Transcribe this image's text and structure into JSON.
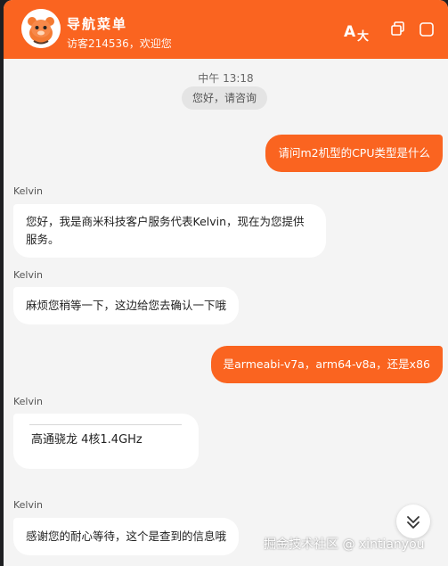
{
  "header": {
    "title": "导航菜单",
    "subtitle": "访客214536，欢迎您",
    "translate_icon": "translate-icon",
    "window_icon": "window-popout-icon",
    "avatar_icon": "mascot-avatar-icon",
    "accent": "#fa6420"
  },
  "chat": {
    "time": "中午 13:18",
    "system_message": "您好，请咨询",
    "messages": [
      {
        "sender": "",
        "text": "请问m2机型的CPU类型是什么"
      },
      {
        "sender": "Kelvin",
        "text_line1": "您好，我是商米科技客户服务代表Kelvin，现在为您提供",
        "text_line2": "服务。"
      },
      {
        "sender": "Kelvin",
        "text": "麻烦您稍等一下，这边给您去确认一下哦"
      },
      {
        "sender": "",
        "text": "是armeabi-v7a，arm64-v8a，还是x86"
      },
      {
        "sender": "Kelvin",
        "text": "高通骁龙  4核1.4GHz"
      },
      {
        "sender": "Kelvin",
        "text": "感谢您的耐心等待，这个是查到的信息哦"
      }
    ]
  },
  "scroll_down_icon": "chevron-double-down-icon",
  "watermark": "掘金技术社区 @ xintianyou"
}
